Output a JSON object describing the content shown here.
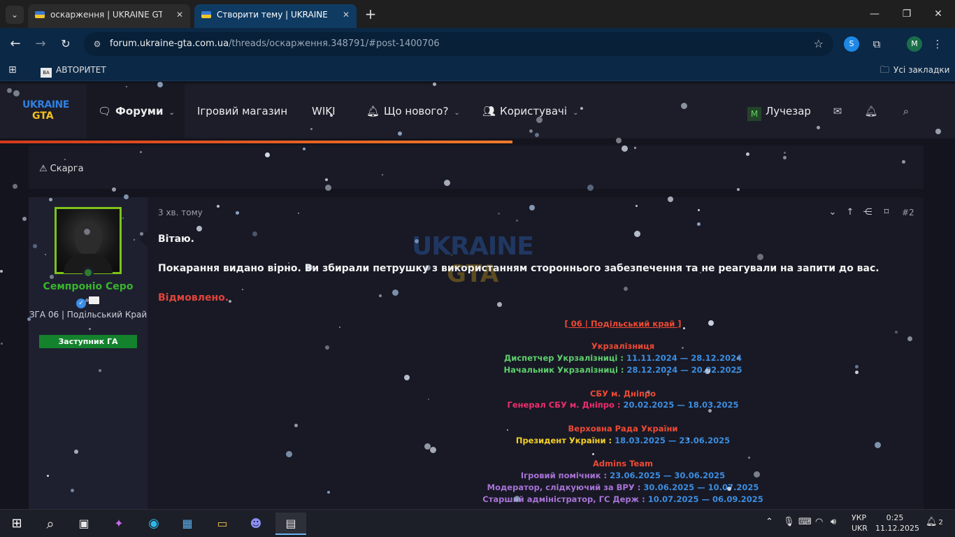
{
  "browser": {
    "tabs": [
      {
        "title": "оскарження | UKRAINE GTA - l",
        "active": false
      },
      {
        "title": "Створити тему | UKRAINE GTA",
        "active": true
      }
    ],
    "url_domain": "forum.ukraine-gta.com.ua",
    "url_path": "/threads/оскарження.348791/#post-1400706",
    "profile_initial": "M",
    "bookmark_item": "АВТОРИТЕТ",
    "bookmarks_all": "Усі закладки"
  },
  "forum": {
    "logo_top": "UKRAINE",
    "logo_bottom": "GTA",
    "nav": {
      "forums": "Форуми",
      "shop": "Ігровий магазин",
      "wiki": "WIKI",
      "whats_new": "Що нового?",
      "users": "Користувачі",
      "account": "Лучезар"
    },
    "report_label": "Скарга",
    "post": {
      "time": "3 хв. тому",
      "number": "#2",
      "greeting": "Вітаю.",
      "body": "Покарання видано вірно. Ви збирали петрушку з використанням стороннього забезпечення та не реагували на запити до вас.",
      "verdict": "Відмовлено."
    },
    "author": {
      "name": "Семпроніо Серо",
      "title": "ЗГА 06 | Подільський Край",
      "banner": "Заступник ГА"
    },
    "signature": {
      "server": "[ 06 | Подільський край ]",
      "groups": [
        {
          "name": "Укрзалізниця",
          "roles": [
            {
              "role": "Диспетчер Укрзалізниці : ",
              "dates": "11.11.2024 — 28.12.2024"
            },
            {
              "role": "Начальник Укрзалізниці : ",
              "dates": "28.12.2024 — 20.02.2025"
            }
          ]
        },
        {
          "name": "СБУ м. Дніпро",
          "roles": [
            {
              "role": "Генерал СБУ м. Дніпро : ",
              "dates": "20.02.2025 — 18.03.2025"
            }
          ]
        },
        {
          "name": "Верховна Рада України",
          "roles": [
            {
              "role": "Президент України : ",
              "dates": "18.03.2025 — 23.06.2025"
            }
          ]
        },
        {
          "name": "Admins Team",
          "roles": [
            {
              "role": "Ігровий помічник : ",
              "dates": "23.06.2025 — 30.06.2025"
            },
            {
              "role": "Модератор, слідкуючий за ВРУ : ",
              "dates": "30.06.2025 — 10.07.2025"
            },
            {
              "role": "Старший адміністратор, ГС Держ : ",
              "dates": "10.07.2025 — 06.09.2025"
            }
          ]
        }
      ]
    }
  },
  "taskbar": {
    "lang_top": "УКР",
    "lang_bottom": "UKR",
    "time": "0:25",
    "date": "11.12.2025",
    "notifications": "2"
  },
  "colors": {
    "accent_green": "#39b52d",
    "verdict_red": "#e0443a",
    "date_blue": "#3c8de0"
  }
}
